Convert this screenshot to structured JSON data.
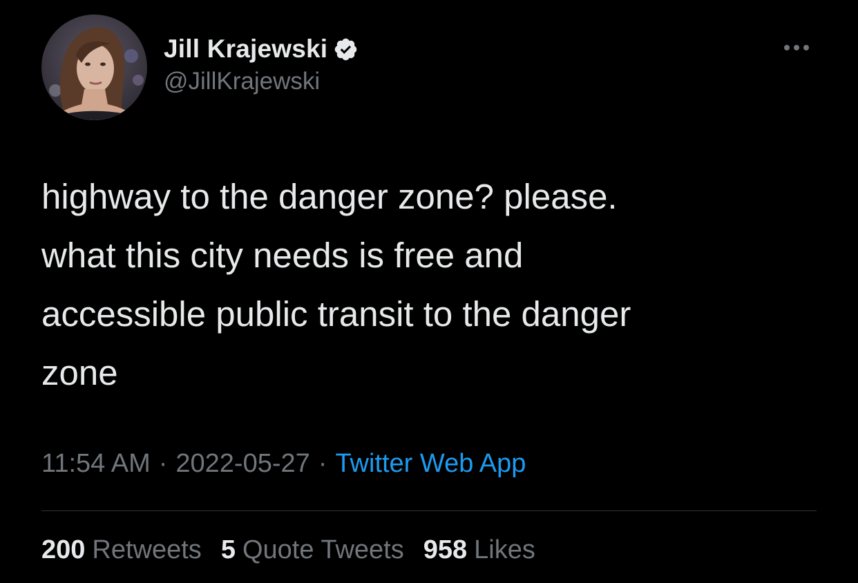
{
  "colors": {
    "background": "#000000",
    "primary_text": "#e7e9ea",
    "secondary_text": "#71767b",
    "link": "#1d9bf0",
    "divider": "#2f3336",
    "verified_badge": "#e7e9ea"
  },
  "author": {
    "display_name": "Jill Krajewski",
    "handle": "@JillKrajewski",
    "verified": true,
    "verified_icon": "verified-badge-icon",
    "avatar_icon": "profile-photo"
  },
  "more_menu": {
    "icon": "more-horizontal-icon"
  },
  "tweet": {
    "text": "highway to the danger zone? please.\nwhat this city needs is free and\naccessible public transit to the danger\nzone"
  },
  "meta": {
    "time": "11:54 AM",
    "separator_1": "·",
    "date": "2022-05-27",
    "separator_2": "·",
    "source": "Twitter Web App"
  },
  "stats": {
    "retweets": {
      "count": "200",
      "label": "Retweets"
    },
    "quotes": {
      "count": "5",
      "label": "Quote Tweets"
    },
    "likes": {
      "count": "958",
      "label": "Likes"
    }
  }
}
